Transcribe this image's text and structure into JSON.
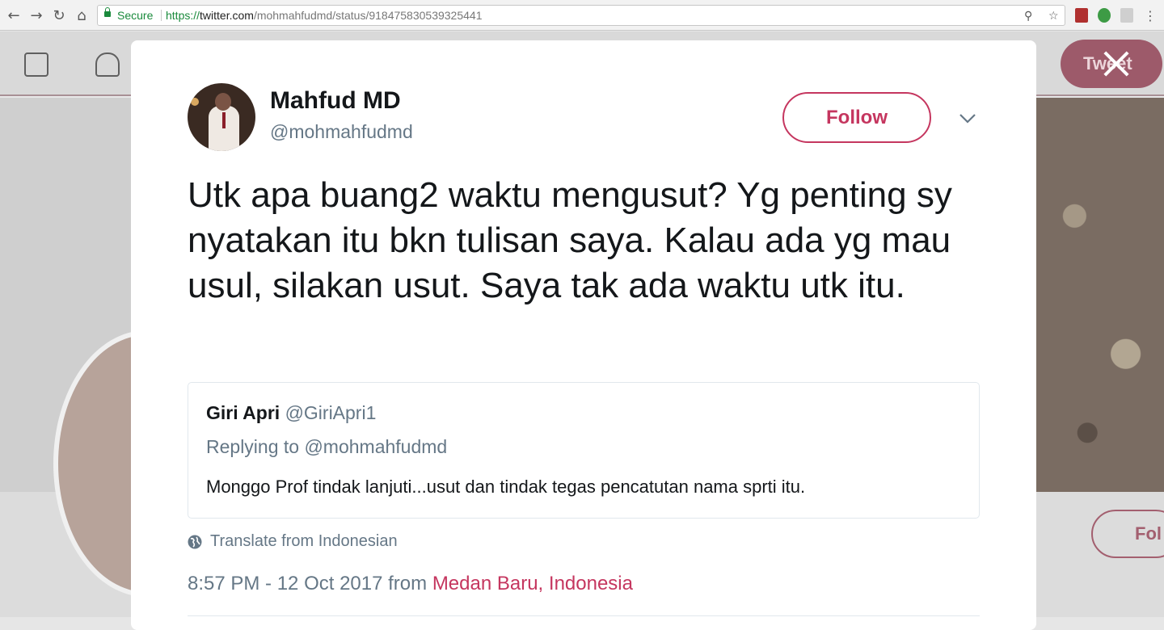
{
  "browser": {
    "secure_label": "Secure",
    "url_scheme": "https://",
    "url_host": "twitter.com",
    "url_path": "/mohmahfudmd/status/918475830539325441",
    "icons": [
      "back-icon",
      "forward-icon",
      "reload-icon",
      "home-icon",
      "zoom-icon",
      "star-icon",
      "menu-icon"
    ]
  },
  "background": {
    "tweet_button": "Tweet",
    "follow_button": "Fol"
  },
  "tweet": {
    "author_name": "Mahfud MD",
    "author_handle": "@mohmahfudmd",
    "follow_label": "Follow",
    "text": "Utk apa buang2 waktu mengusut? Yg penting sy nyatakan itu bkn tulisan saya. Kalau ada yg mau usul, silakan usut. Saya tak ada waktu utk itu.",
    "quoted": {
      "name": "Giri Apri",
      "handle": "@GiriApri1",
      "replying_to": "Replying to @mohmahfudmd",
      "text": "Monggo Prof tindak lanjuti...usut dan tindak tegas pencatutan nama sprti itu."
    },
    "translate_label": "Translate from Indonesian",
    "timestamp": "8:57 PM - 12 Oct 2017 from ",
    "location": "Medan Baru, Indonesia"
  },
  "colors": {
    "accent": "#c5365f",
    "secondary_text": "#657786",
    "primary_text": "#14171a",
    "secure_green": "#1a8a3c"
  }
}
